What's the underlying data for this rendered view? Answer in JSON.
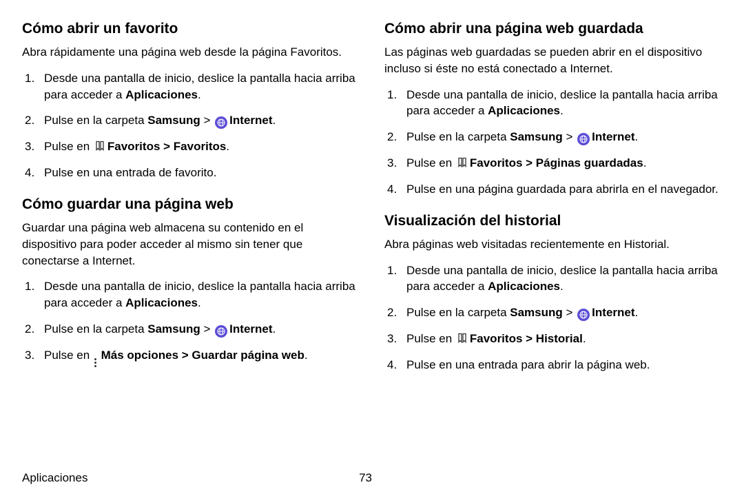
{
  "left": {
    "section1": {
      "heading": "Cómo abrir un favorito",
      "intro": "Abra rápidamente una página web desde la página Favoritos.",
      "steps": {
        "s1a": "Desde una pantalla de inicio, deslice la pantalla hacia arriba para acceder a ",
        "s1b": "Aplicaciones",
        "s1c": ".",
        "s2a": "Pulse en la carpeta ",
        "s2b": "Samsung",
        "s2c": " > ",
        "s2d": "Internet",
        "s2e": ".",
        "s3a": "Pulse en ",
        "s3b": "Favoritos",
        "s3c": " > ",
        "s3d": "Favoritos",
        "s3e": ".",
        "s4": "Pulse en una entrada de favorito."
      }
    },
    "section2": {
      "heading": "Cómo guardar una página web",
      "intro": "Guardar una página web almacena su contenido en el dispositivo para poder acceder al mismo sin tener que conectarse a Internet.",
      "steps": {
        "s1a": "Desde una pantalla de inicio, deslice la pantalla hacia arriba para acceder a ",
        "s1b": "Aplicaciones",
        "s1c": ".",
        "s2a": "Pulse en la carpeta ",
        "s2b": "Samsung",
        "s2c": " > ",
        "s2d": "Internet",
        "s2e": ".",
        "s3a": "Pulse en ",
        "s3b": "Más opciones",
        "s3c": " > ",
        "s3d": "Guardar página web",
        "s3e": "."
      }
    }
  },
  "right": {
    "section1": {
      "heading": "Cómo abrir una página web guardada",
      "intro": "Las páginas web guardadas se pueden abrir en el dispositivo incluso si éste no está conectado a Internet.",
      "steps": {
        "s1a": "Desde una pantalla de inicio, deslice la pantalla hacia arriba para acceder a ",
        "s1b": "Aplicaciones",
        "s1c": ".",
        "s2a": "Pulse en la carpeta ",
        "s2b": "Samsung",
        "s2c": " > ",
        "s2d": "Internet",
        "s2e": ".",
        "s3a": "Pulse en ",
        "s3b": "Favoritos",
        "s3c": " > ",
        "s3d": "Páginas guardadas",
        "s3e": ".",
        "s4": "Pulse en una página guardada para abrirla en el navegador."
      }
    },
    "section2": {
      "heading": "Visualización del historial",
      "intro": "Abra páginas web visitadas recientemente en Historial.",
      "steps": {
        "s1a": "Desde una pantalla de inicio, deslice la pantalla hacia arriba para acceder a ",
        "s1b": "Aplicaciones",
        "s1c": ".",
        "s2a": "Pulse en la carpeta ",
        "s2b": "Samsung",
        "s2c": " > ",
        "s2d": "Internet",
        "s2e": ".",
        "s3a": "Pulse en ",
        "s3b": "Favoritos",
        "s3c": " > ",
        "s3d": "Historial",
        "s3e": ".",
        "s4": "Pulse en una entrada para abrir la página web."
      }
    }
  },
  "footer": {
    "section": "Aplicaciones",
    "page": "73"
  }
}
